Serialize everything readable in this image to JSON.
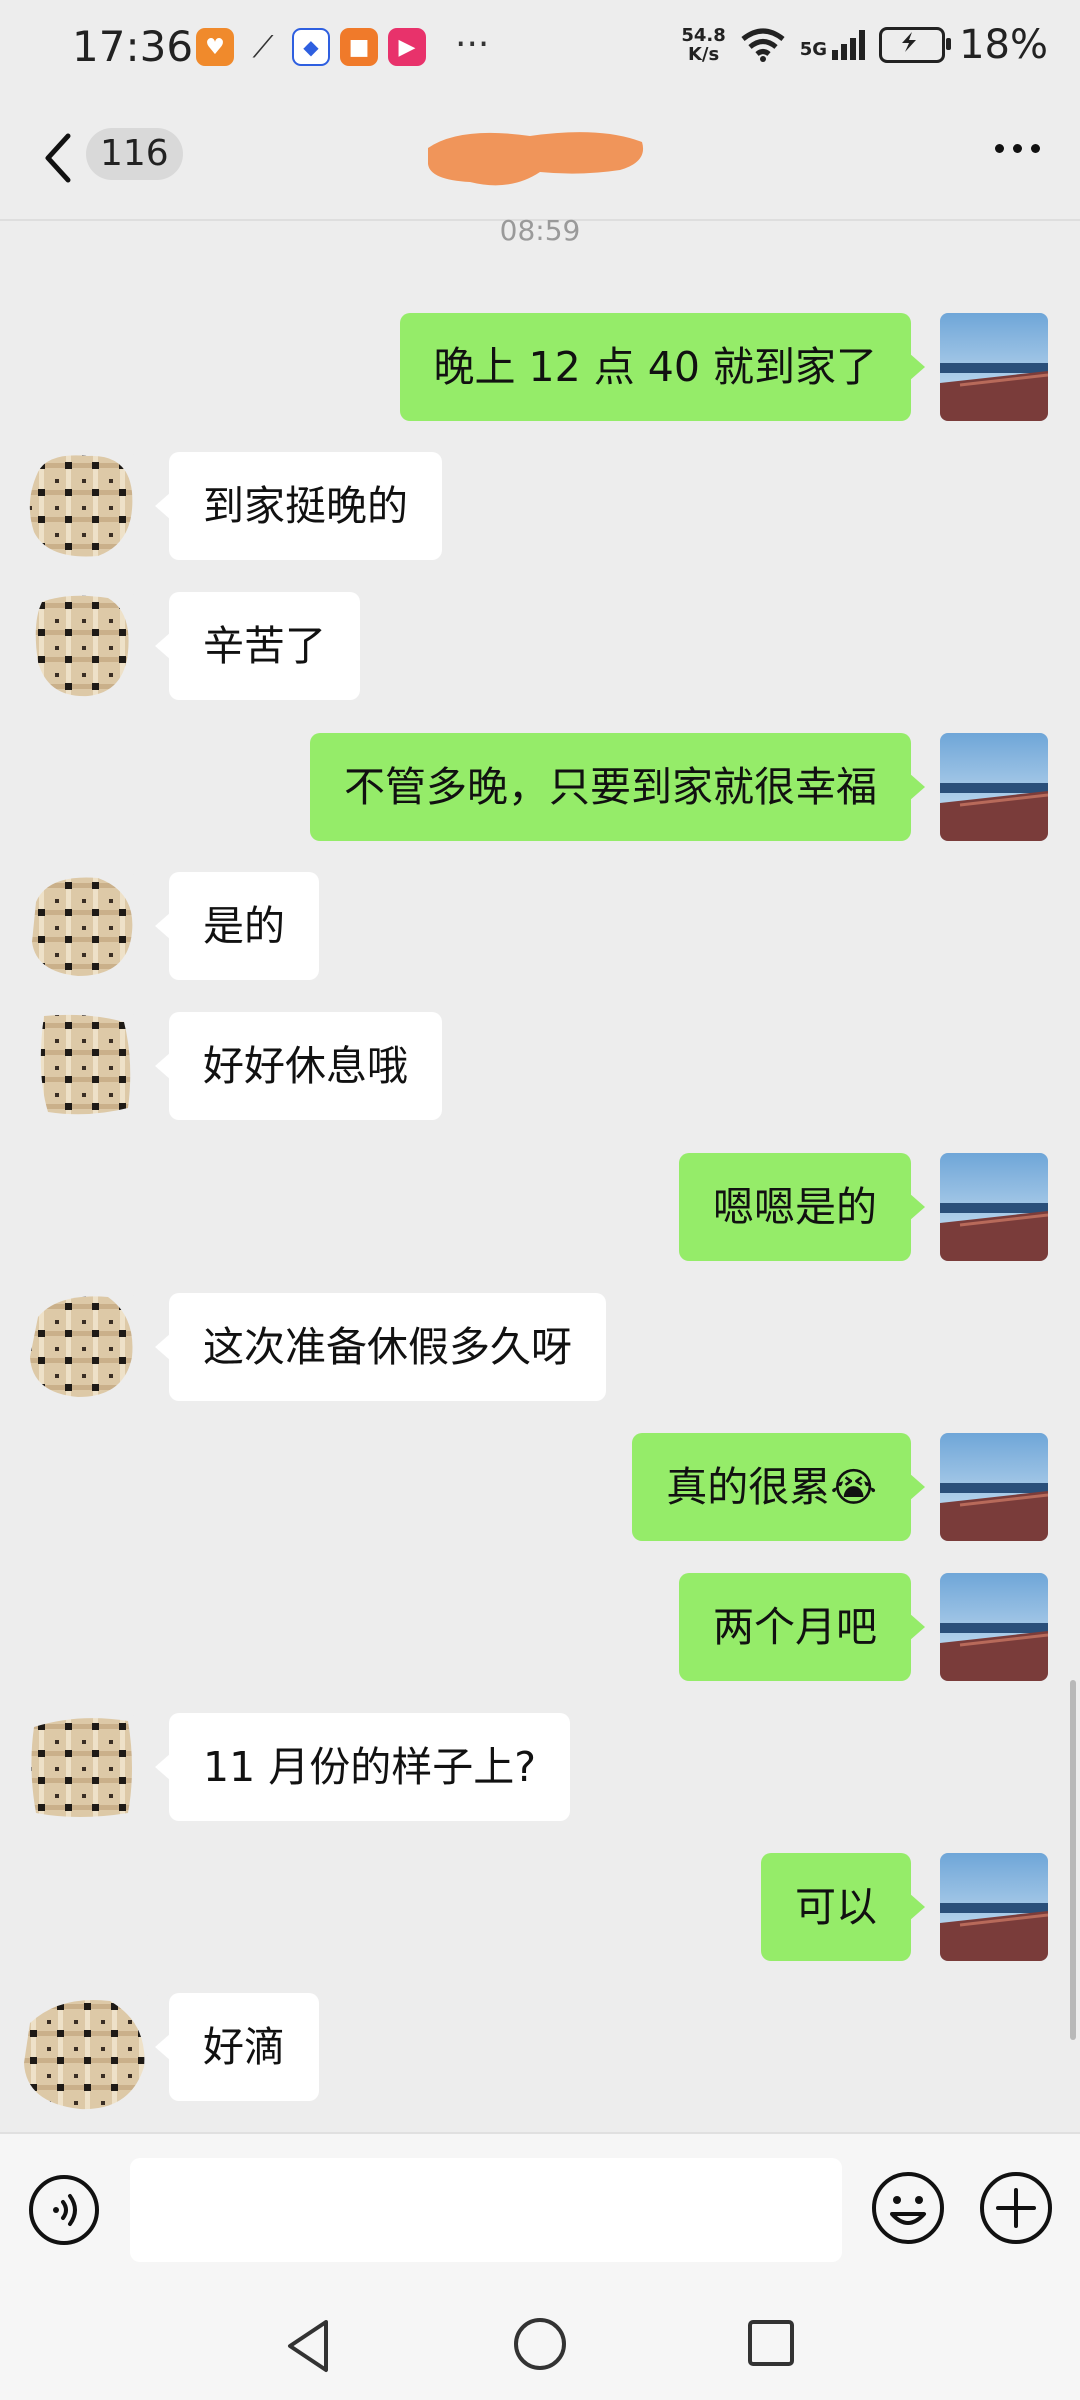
{
  "status_bar": {
    "time": "17:36",
    "net_speed_value": "54.8",
    "net_speed_unit": "K/s",
    "network": "5G",
    "battery": "18%"
  },
  "header": {
    "unread_count": "116"
  },
  "timestamp": "08:59",
  "messages": [
    {
      "from": "me",
      "text": "晚上 12 点 40 就到家了"
    },
    {
      "from": "other",
      "text": "到家挺晚的"
    },
    {
      "from": "other",
      "text": "辛苦了"
    },
    {
      "from": "me",
      "text": "不管多晚，只要到家就很幸福"
    },
    {
      "from": "other",
      "text": "是的"
    },
    {
      "from": "other",
      "text": "好好休息哦"
    },
    {
      "from": "me",
      "text": "嗯嗯是的"
    },
    {
      "from": "other",
      "text": "这次准备休假多久呀"
    },
    {
      "from": "me",
      "text": "真的很累",
      "emoji": "😭"
    },
    {
      "from": "me",
      "text": "两个月吧"
    },
    {
      "from": "other",
      "text": "11 月份的样子上?"
    },
    {
      "from": "me",
      "text": "可以"
    },
    {
      "from": "other",
      "text": "好滴"
    }
  ],
  "colors": {
    "my_bubble": "#95ec69",
    "their_bubble": "#ffffff",
    "background": "#ededed"
  }
}
